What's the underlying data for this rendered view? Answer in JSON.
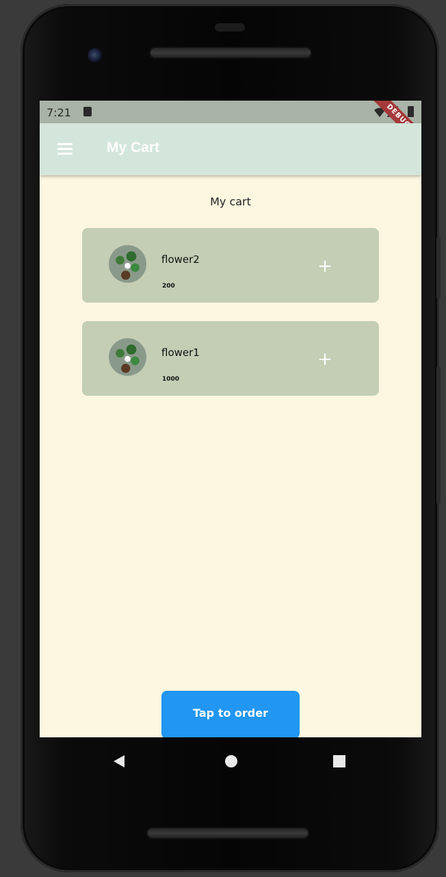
{
  "status_bar": {
    "time": "7:21",
    "debug_label": "DEBUG"
  },
  "app_bar": {
    "title": "My Cart",
    "menu_icon": "hamburger-menu-icon"
  },
  "content": {
    "title": "My cart",
    "items": [
      {
        "name": "flower2",
        "price": "200",
        "add_icon": "plus-icon"
      },
      {
        "name": "flower1",
        "price": "1000",
        "add_icon": "plus-icon"
      }
    ]
  },
  "order_button": {
    "label": "Tap to order",
    "color": "#2196f3"
  },
  "colors": {
    "app_bar": "#d4e6db",
    "status_bar": "#a9b3a7",
    "background": "#fdf6e0",
    "card": "#c3ceb5",
    "debug_ribbon": "#a4393a"
  },
  "nav_bar": {
    "back": "back-triangle-icon",
    "home": "home-circle-icon",
    "recents": "recents-square-icon"
  }
}
